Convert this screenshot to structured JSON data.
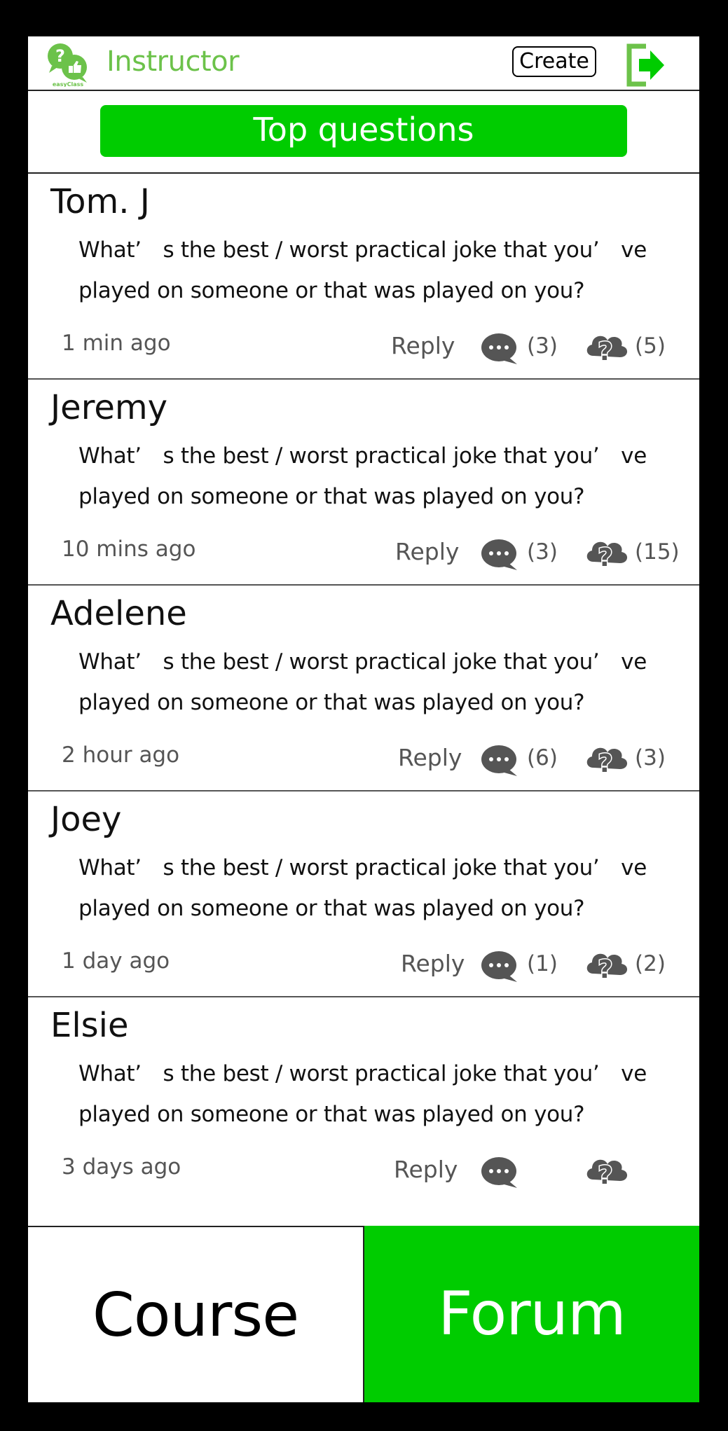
{
  "header": {
    "logo_text": "easyClass",
    "title": "Instructor",
    "create_label": "Create"
  },
  "banner": {
    "label": "Top questions"
  },
  "questions": [
    {
      "author": "Tom. J",
      "text": "What’　s the best / worst practical joke that you’　ve played on someone or that was played on you?",
      "time": "1 min ago",
      "reply_label": "Reply",
      "comments": "(3)",
      "questions": "(5)"
    },
    {
      "author": "Jeremy",
      "text": "What’　s the best / worst practical joke that you’　ve played on someone or that was played on you?",
      "time": "10 mins ago",
      "reply_label": "Reply",
      "comments": "(3)",
      "questions": "(15)"
    },
    {
      "author": "Adelene",
      "text": "What’　s the best / worst practical joke that you’　ve played on someone or that was played on you?",
      "time": "2 hour ago",
      "reply_label": "Reply",
      "comments": "(6)",
      "questions": "(3)"
    },
    {
      "author": "Joey",
      "text": "What’　s the best / worst practical joke that you’　ve played on someone or that was played on you?",
      "time": "1 day ago",
      "reply_label": "Reply",
      "comments": "(1)",
      "questions": "(2)"
    },
    {
      "author": "Elsie",
      "text": "What’　s the best / worst practical joke that you’　ve played on someone or that was played on you?",
      "time": "3 days ago",
      "reply_label": "Reply",
      "comments": "",
      "questions": ""
    }
  ],
  "nav": {
    "course_label": "Course",
    "forum_label": "Forum"
  },
  "icons": {
    "logo": "easyclass-logo-icon",
    "logout": "exit-icon",
    "comment": "comment-bubble-icon",
    "question": "question-cloud-icon"
  },
  "colors": {
    "accent_green": "#00cc00",
    "title_green": "#6cc24a",
    "icon_gray": "#555555"
  }
}
